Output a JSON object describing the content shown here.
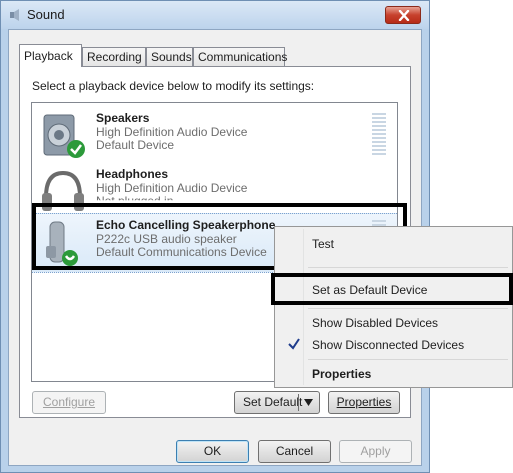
{
  "window": {
    "title": "Sound"
  },
  "tabs": [
    {
      "label": "Playback"
    },
    {
      "label": "Recording"
    },
    {
      "label": "Sounds"
    },
    {
      "label": "Communications"
    }
  ],
  "instruction": "Select a playback device below to modify its settings:",
  "devices": [
    {
      "name": "Speakers",
      "description": "High Definition Audio Device",
      "status": "Default Device",
      "icon": "speaker-icon",
      "badge": "green-check-icon"
    },
    {
      "name": "Headphones",
      "description": "High Definition Audio Device",
      "status": "Not plugged in",
      "icon": "headphones-icon"
    },
    {
      "name": "Echo Cancelling Speakerphone",
      "description": "P222c USB audio speaker",
      "status": "Default Communications Device",
      "icon": "phone-handset-icon",
      "badge": "green-phone-icon"
    }
  ],
  "context_menu": {
    "items": [
      {
        "label": "Test"
      },
      {
        "label": "Set as Default Device"
      },
      {
        "label": "Show Disabled Devices"
      },
      {
        "label": "Show Disconnected Devices",
        "checked": true
      },
      {
        "label": "Properties"
      }
    ]
  },
  "panel_buttons": {
    "configure": "Configure",
    "set_default": "Set Default",
    "properties": "Properties"
  },
  "dialog_buttons": {
    "ok": "OK",
    "cancel": "Cancel",
    "apply": "Apply"
  },
  "colors": {
    "titlebar": "#bcd3ec",
    "close_button": "#c7412d",
    "selection": "#d9e9f8",
    "highlight_box": "#000000",
    "check_badge": "#2c9a3a"
  }
}
